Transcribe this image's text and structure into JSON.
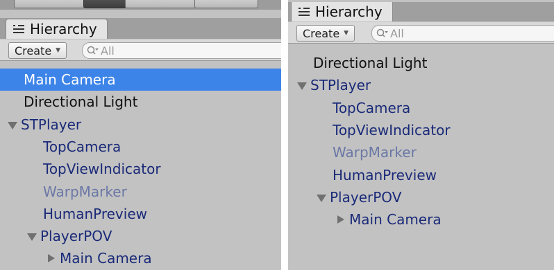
{
  "left_panel": {
    "tab_title": "Hierarchy",
    "create_label": "Create",
    "search_placeholder": "All",
    "items": [
      {
        "label": "Main Camera",
        "depth": 0,
        "expand": "none",
        "style": "selected"
      },
      {
        "label": "Directional Light",
        "depth": 0,
        "expand": "none",
        "style": "black"
      },
      {
        "label": "STPlayer",
        "depth": 0,
        "expand": "expanded",
        "style": "blue"
      },
      {
        "label": "TopCamera",
        "depth": 1,
        "expand": "none",
        "style": "blue"
      },
      {
        "label": "TopViewIndicator",
        "depth": 1,
        "expand": "none",
        "style": "blue"
      },
      {
        "label": "WarpMarker",
        "depth": 1,
        "expand": "none",
        "style": "muted"
      },
      {
        "label": "HumanPreview",
        "depth": 1,
        "expand": "none",
        "style": "blue"
      },
      {
        "label": "PlayerPOV",
        "depth": 1,
        "expand": "expanded",
        "style": "blue"
      },
      {
        "label": "Main Camera",
        "depth": 2,
        "expand": "collapsed",
        "style": "blue"
      }
    ]
  },
  "right_panel": {
    "tab_title": "Hierarchy",
    "create_label": "Create",
    "search_placeholder": "All",
    "items": [
      {
        "label": "Directional Light",
        "depth": 0,
        "expand": "none",
        "style": "black"
      },
      {
        "label": "STPlayer",
        "depth": 0,
        "expand": "expanded",
        "style": "blue"
      },
      {
        "label": "TopCamera",
        "depth": 1,
        "expand": "none",
        "style": "blue"
      },
      {
        "label": "TopViewIndicator",
        "depth": 1,
        "expand": "none",
        "style": "blue"
      },
      {
        "label": "WarpMarker",
        "depth": 1,
        "expand": "none",
        "style": "muted"
      },
      {
        "label": "HumanPreview",
        "depth": 1,
        "expand": "none",
        "style": "blue"
      },
      {
        "label": "PlayerPOV",
        "depth": 1,
        "expand": "expanded",
        "style": "blue"
      },
      {
        "label": "Main Camera",
        "depth": 2,
        "expand": "collapsed",
        "style": "blue"
      }
    ]
  },
  "colors": {
    "selection": "#3d84e8",
    "prefab_text": "#1a2a78",
    "inactive_text": "#6b78a6",
    "panel_bg": "#c2c2c2"
  }
}
